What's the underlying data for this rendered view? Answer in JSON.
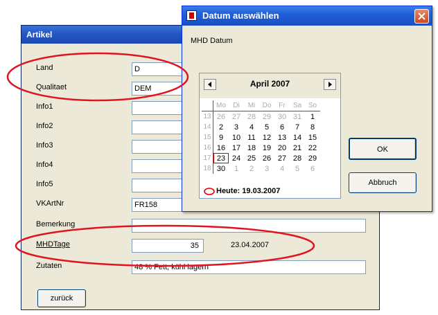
{
  "artikel": {
    "title": "Artikel",
    "fields": [
      {
        "label": "Land",
        "value": "D"
      },
      {
        "label": "Qualitaet",
        "value": "DEM"
      },
      {
        "label": "Info1",
        "value": ""
      },
      {
        "label": "Info2",
        "value": ""
      },
      {
        "label": "Info3",
        "value": ""
      },
      {
        "label": "Info4",
        "value": ""
      },
      {
        "label": "Info5",
        "value": ""
      },
      {
        "label": "VKArtNr",
        "value": "FR158"
      },
      {
        "label": "Bemerkung",
        "value": ""
      }
    ],
    "mhd": {
      "label": "MHDTage",
      "value": "35",
      "date": "23.04.2007"
    },
    "zutaten": {
      "label": "Zutaten",
      "value": "48 % Fett, kühl lagern"
    },
    "back_button": "zurück"
  },
  "datum_dialog": {
    "title": "Datum auswählen",
    "subtitle": "MHD Datum",
    "month_label": "April 2007",
    "weekdays": [
      "Mo",
      "Di",
      "Mi",
      "Do",
      "Fr",
      "Sa",
      "So"
    ],
    "weeks": [
      {
        "wk": "13",
        "days": [
          "26",
          "27",
          "28",
          "29",
          "30",
          "31",
          "1"
        ]
      },
      {
        "wk": "14",
        "days": [
          "2",
          "3",
          "4",
          "5",
          "6",
          "7",
          "8"
        ]
      },
      {
        "wk": "15",
        "days": [
          "9",
          "10",
          "11",
          "12",
          "13",
          "14",
          "15"
        ]
      },
      {
        "wk": "16",
        "days": [
          "16",
          "17",
          "18",
          "19",
          "20",
          "21",
          "22"
        ]
      },
      {
        "wk": "17",
        "days": [
          "23",
          "24",
          "25",
          "26",
          "27",
          "28",
          "29"
        ]
      },
      {
        "wk": "18",
        "days": [
          "30",
          "1",
          "2",
          "3",
          "4",
          "5",
          "6"
        ]
      }
    ],
    "selected_day": "23",
    "today_label": "Heute: 19.03.2007",
    "ok_button": "OK",
    "cancel_button": "Abbruch"
  },
  "colors": {
    "titlebar": "#2457c5",
    "annotation": "#e0141e",
    "window_bg": "#ece9d8"
  }
}
